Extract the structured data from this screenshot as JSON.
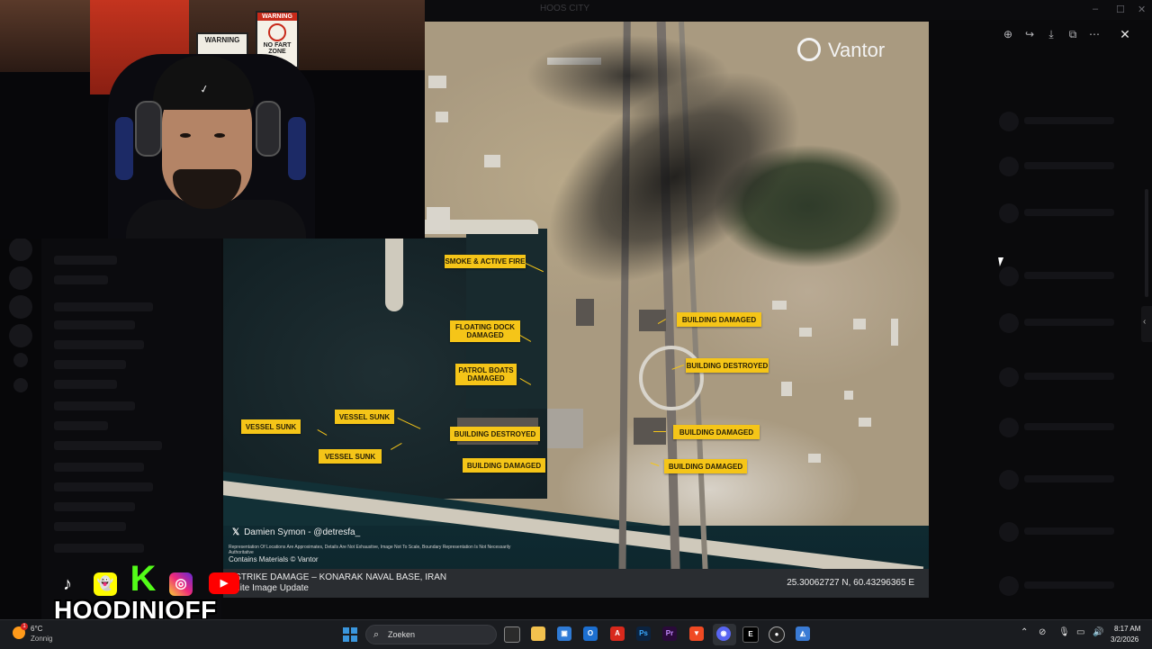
{
  "window": {
    "title": "HOOS CITY"
  },
  "viewer_toolbar": {
    "zoom_icon": "zoom-in-icon",
    "forward_icon": "forward-icon",
    "download_icon": "download-icon",
    "open_icon": "open-external-icon",
    "more_icon": "more-icon",
    "close_icon": "close-icon"
  },
  "image": {
    "brand": "Vantor",
    "labels": [
      "SMOKE & ACTIVE FIRE",
      "FLOATING DOCK DAMAGED",
      "PATROL BOATS DAMAGED",
      "VESSEL SUNK",
      "VESSEL SUNK",
      "VESSEL SUNK",
      "BUILDING DESTROYED",
      "BUILDING DAMAGED",
      "BUILDING DAMAGED",
      "BUILDING DESTROYED",
      "BUILDING DAMAGED",
      "BUILDING DAMAGED"
    ],
    "attribution": "Damien Symon - @detresfa_",
    "disclaimer": "Representation Of Locations Are Approximates, Details Are Not Exhaustive, Image Not To Scale, Boundary Representation Is Not Necessarily Authoritative",
    "credit": "Contains Materials © Vantor",
    "caption_line1": "RSTRIKE DAMAGE – KONARAK NAVAL BASE, IRAN",
    "caption_line2": "tellite Image Update",
    "coordinates": "25.30062727 N, 60.43296365 E"
  },
  "webcam": {
    "sign1": "WARNING",
    "sign2_top": "WARNING",
    "sign2_bottom": "NO FART ZONE"
  },
  "social": {
    "handle": "HOODINIOFF",
    "icons": [
      "tiktok-icon",
      "snapchat-icon",
      "kick-icon",
      "instagram-icon",
      "youtube-icon"
    ]
  },
  "taskbar": {
    "weather_badge": "1",
    "weather_temp": "6°C",
    "weather_desc": "Zonnig",
    "search_placeholder": "Zoeken",
    "time": "8:17 AM",
    "date": "3/2/2026"
  }
}
